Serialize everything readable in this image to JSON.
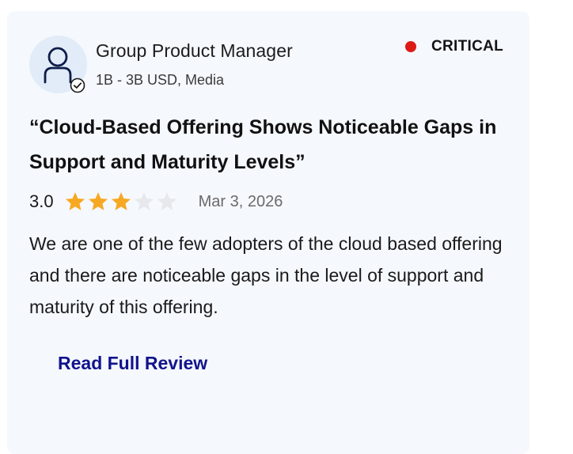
{
  "reviewer": {
    "avatar_icon": "person-icon",
    "verified_icon": "verified-check-icon",
    "role": "Group Product Manager",
    "company": "1B - 3B USD, Media"
  },
  "severity": {
    "label": "CRITICAL",
    "color": "#dc1b14"
  },
  "review": {
    "title": "“Cloud-Based Offering Shows Noticeable Gaps in Support and Maturity Levels”",
    "rating_text": "3.0",
    "rating": 3,
    "max_rating": 5,
    "date": "Mar 3, 2026",
    "body": "We are one of the few adopters of the cloud based offering and there are noticeable gaps in the level of support and maturity of this offering.",
    "read_more_label": "Read Full Review"
  },
  "colors": {
    "card_background": "#f5f8fd",
    "star_filled": "#f7a823",
    "star_empty": "#e6e8ec",
    "link": "#11148c"
  }
}
